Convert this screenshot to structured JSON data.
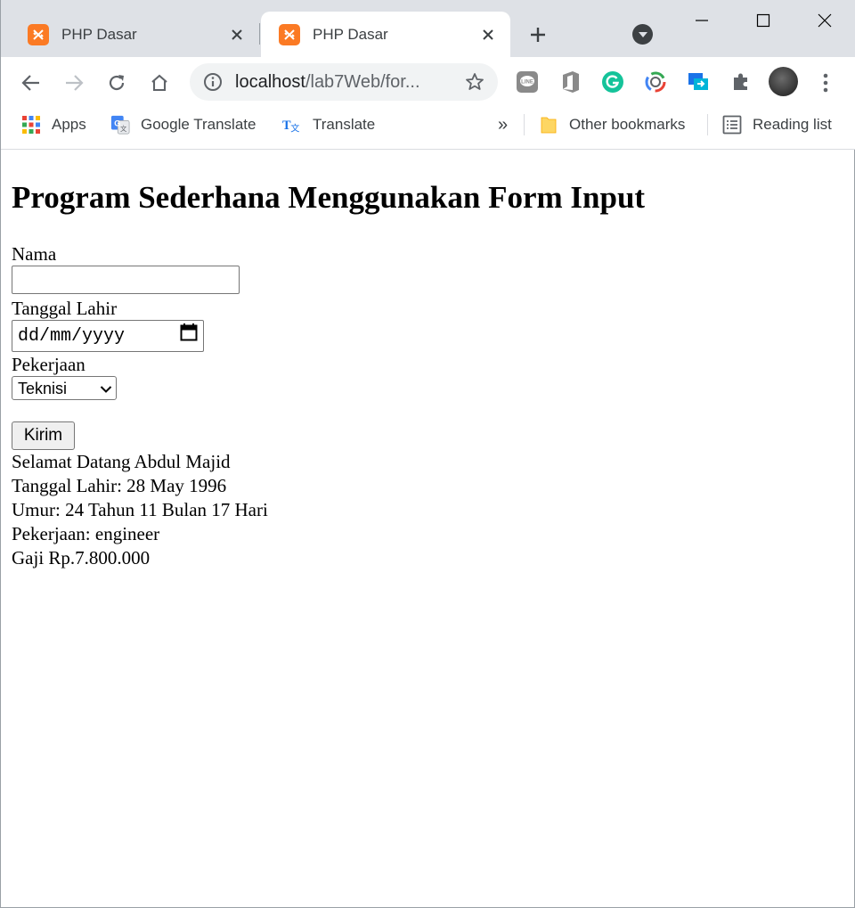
{
  "browser": {
    "tabs": [
      {
        "title": "PHP Dasar",
        "active": false
      },
      {
        "title": "PHP Dasar",
        "active": true
      }
    ],
    "url_host": "localhost",
    "url_path": "/lab7Web/for...",
    "bookmarks": {
      "apps": "Apps",
      "google_translate": "Google Translate",
      "translate": "Translate",
      "overflow": "»",
      "other": "Other bookmarks",
      "reading_list": "Reading list"
    },
    "colors": {
      "tabstrip": "#dee1e6",
      "xampp_orange": "#fb7a24",
      "omnibox": "#f1f3f4"
    }
  },
  "page": {
    "heading": "Program Sederhana Menggunakan Form Input",
    "form": {
      "nama_label": "Nama",
      "nama_value": "",
      "tanggal_label": "Tanggal Lahir",
      "tanggal_placeholder": "dd/mm/yyyy",
      "pekerjaan_label": "Pekerjaan",
      "pekerjaan_selected": "Teknisi",
      "submit_label": "Kirim"
    },
    "result": {
      "line1": "Selamat Datang Abdul Majid",
      "line2": "Tanggal Lahir: 28 May 1996",
      "line3": "Umur: 24 Tahun 11 Bulan 17 Hari",
      "line4": "Pekerjaan: engineer",
      "line5": "Gaji Rp.7.800.000"
    }
  }
}
